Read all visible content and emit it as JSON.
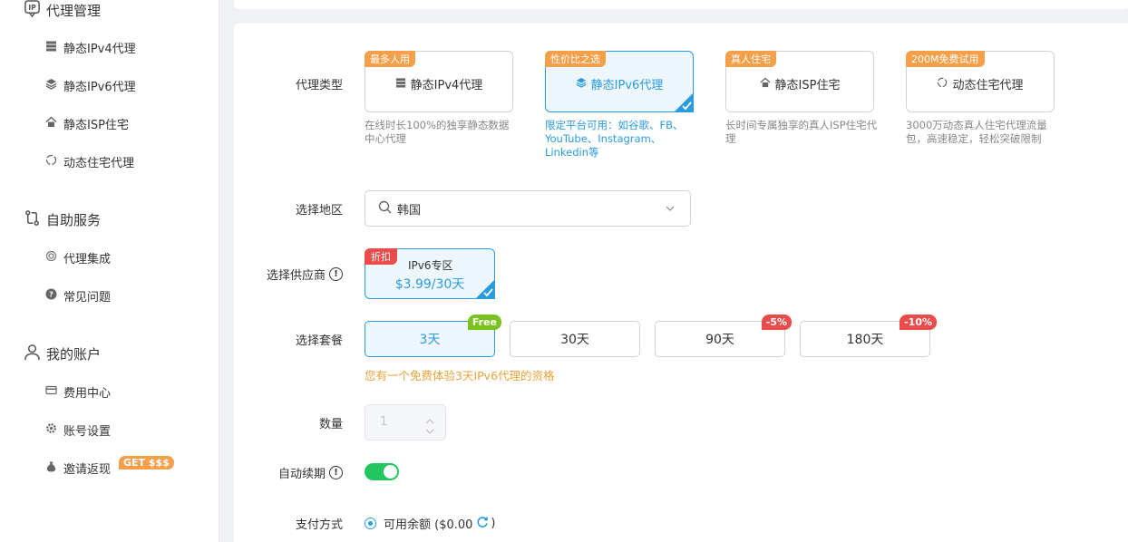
{
  "sidebar": {
    "proxy_section": {
      "label": "代理管理"
    },
    "proxy_items": [
      {
        "label": "静态IPv4代理"
      },
      {
        "label": "静态IPv6代理"
      },
      {
        "label": "静态ISP住宅"
      },
      {
        "label": "动态住宅代理"
      }
    ],
    "self_service_section": {
      "label": "自助服务"
    },
    "self_service_items": [
      {
        "label": "代理集成"
      },
      {
        "label": "常见问题"
      }
    ],
    "account_section": {
      "label": "我的账户"
    },
    "account_items": [
      {
        "label": "费用中心"
      },
      {
        "label": "账号设置"
      },
      {
        "label": "邀请返现",
        "badge": "GET $$$"
      }
    ]
  },
  "form": {
    "proxy_type": {
      "label": "代理类型",
      "cards": [
        {
          "tag": "最多人用",
          "title": "静态IPv4代理",
          "desc": "在线时长100%的独享静态数据中心代理",
          "selected": false
        },
        {
          "tag": "性价比之选",
          "title": "静态IPv6代理",
          "desc": "限定平台可用：如谷歌、FB、YouTube、Instagram、Linkedin等",
          "selected": true
        },
        {
          "tag": "真人住宅",
          "title": "静态ISP住宅",
          "desc": "长时间专属独享的真人ISP住宅代理",
          "selected": false
        },
        {
          "tag": "200M免费试用",
          "title": "动态住宅代理",
          "desc": "3000万动态真人住宅代理流量包，高速稳定，轻松突破限制",
          "selected": false
        }
      ]
    },
    "region": {
      "label": "选择地区",
      "value": "韩国"
    },
    "vendor": {
      "label": "选择供应商",
      "tag": "折扣",
      "name": "IPv6专区",
      "price": "$3.99/30天"
    },
    "package": {
      "label": "选择套餐",
      "options": [
        {
          "label": "3天",
          "tag": "Free",
          "selected": true
        },
        {
          "label": "30天",
          "tag": "",
          "selected": false
        },
        {
          "label": "90天",
          "tag": "-5%",
          "selected": false
        },
        {
          "label": "180天",
          "tag": "-10%",
          "selected": false
        }
      ],
      "notice": "您有一个免费体验3天IPv6代理的资格"
    },
    "quantity": {
      "label": "数量",
      "value": "1"
    },
    "auto_renew": {
      "label": "自动续期",
      "enabled": true
    },
    "payment": {
      "label": "支付方式",
      "option": "可用余额 ($0.00",
      "close": ")"
    }
  },
  "colors": {
    "accent": "#2b9be0",
    "orange": "#f4a04a",
    "red": "#ea4b4b",
    "green": "#22c55e",
    "lime": "#7ac21c",
    "notice": "#e9a23b"
  }
}
